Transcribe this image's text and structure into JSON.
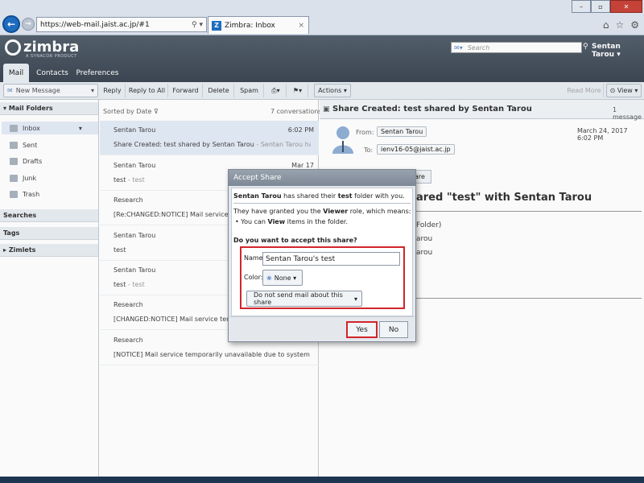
{
  "browser": {
    "url": "https://web-mail.jaist.ac.jp/#1",
    "tab_title": "Zimbra: Inbox",
    "tab_icon": "Z",
    "search_glyph": "⚲ ▾"
  },
  "header": {
    "brand": "zimbra",
    "sub_brand": "A SYNACOR PRODUCT",
    "search_placeholder": "Search",
    "user_name": "Sentan Tarou",
    "apps": [
      {
        "label": "Mail"
      },
      {
        "label": "Contacts"
      },
      {
        "label": "Preferences"
      }
    ]
  },
  "toolbar": {
    "new_message": "New Message",
    "reply": "Reply",
    "reply_all": "Reply to All",
    "forward": "Forward",
    "delete": "Delete",
    "spam": "Spam",
    "actions": "Actions",
    "read_more": "Read More",
    "view": "View"
  },
  "sidebar": {
    "mail_folders": "Mail Folders",
    "folders": [
      {
        "label": "Inbox"
      },
      {
        "label": "Sent"
      },
      {
        "label": "Drafts"
      },
      {
        "label": "Junk"
      },
      {
        "label": "Trash"
      }
    ],
    "searches": "Searches",
    "tags": "Tags",
    "zimlets": "Zimlets"
  },
  "list": {
    "sort_label": "Sorted by Date",
    "count": "7 conversations",
    "items": [
      {
        "from": "Sentan Tarou",
        "date": "6:02 PM",
        "subject": "Share Created: test shared by Sentan  Tarou",
        "fragment": " - Sentan Tarou has shared"
      },
      {
        "from": "Sentan Tarou",
        "date": "Mar 17",
        "subject": "test",
        "fragment": " - test"
      },
      {
        "from": "Research",
        "date": "",
        "subject": "[Re:CHANGED:NOTICE] Mail service temporarily",
        "fragment": ""
      },
      {
        "from": "Sentan Tarou",
        "date": "",
        "subject": "test",
        "fragment": ""
      },
      {
        "from": "Sentan Tarou",
        "date": "",
        "subject": "test",
        "fragment": " - test"
      },
      {
        "from": "Research",
        "date": "",
        "subject": "[CHANGED:NOTICE] Mail service temporarily",
        "fragment": ""
      },
      {
        "from": "Research",
        "date": "",
        "subject": "[NOTICE] Mail service temporarily unavailable due to system replaceme",
        "fragment": ""
      }
    ]
  },
  "reading": {
    "subject": "Share Created: test shared by Sentan Tarou",
    "msg_count": "1 message",
    "from_label": "From:",
    "from_name": "Sentan Tarou",
    "to_label": "To:",
    "to_addr": "ienv16-05@jaist.ac.jp",
    "date": "March 24, 2017 6:02 PM",
    "accept_fragment": "are",
    "body_title": "ared \"test\" with Sentan Tarou",
    "body_folder": "Folder)",
    "body_line1": "arou",
    "body_line2": "arou"
  },
  "dialog": {
    "title": "Accept Share",
    "line1_user": "Sentan Tarou",
    "line1_mid": " has shared their ",
    "line1_folder": "test",
    "line1_end": " folder with you.",
    "line2_start": "They have granted you the ",
    "line2_role": "Viewer",
    "line2_end": " role, which means:",
    "bullet_start": "You can ",
    "bullet_verb": "View",
    "bullet_end": " items in the folder.",
    "question": "Do you want to accept this share?",
    "name_label": "Name:",
    "name_value": "Sentan  Tarou's test",
    "color_label": "Color:",
    "color_value": "None",
    "mail_option": "Do not send mail about this share",
    "yes": "Yes",
    "no": "No"
  },
  "colors": {
    "highlight": "#d2242a",
    "header_bg": "#4a5561",
    "selected_row": "#e3ebf6"
  }
}
